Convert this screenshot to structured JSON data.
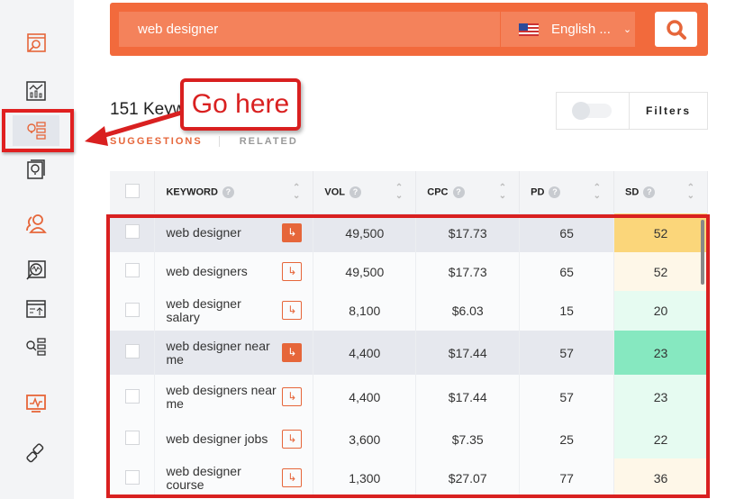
{
  "search": {
    "query": "web designer",
    "language": "English ...",
    "search_icon": "search-icon"
  },
  "sidebar": {
    "items": [
      {
        "icon": "keyword-search-icon",
        "color": "#e6663a"
      },
      {
        "icon": "chart-icon",
        "color": "#333333"
      },
      {
        "icon": "keyword-ideas-icon",
        "color": "#e6663a",
        "active": true
      },
      {
        "icon": "content-ideas-icon",
        "color": "#333333"
      },
      {
        "icon": "users-icon",
        "color": "#e6663a"
      },
      {
        "icon": "site-audit-icon",
        "color": "#333333"
      },
      {
        "icon": "top-pages-icon",
        "color": "#333333"
      },
      {
        "icon": "keyword-list-icon",
        "color": "#333333"
      },
      {
        "icon": "rank-tracking-icon",
        "color": "#e6663a"
      },
      {
        "icon": "backlinks-icon",
        "color": "#333333"
      }
    ]
  },
  "main": {
    "title": "151 Keyw",
    "tabs": [
      {
        "label": "SUGGESTIONS",
        "active": true
      },
      {
        "label": "RELATED"
      }
    ],
    "filters_label": "Filters"
  },
  "annotation": {
    "callout": "Go here"
  },
  "table": {
    "columns": [
      "KEYWORD",
      "VOL",
      "CPC",
      "PD",
      "SD"
    ],
    "rows": [
      {
        "keyword": "web designer",
        "vol": "49,500",
        "cpc": "$17.73",
        "pd": "65",
        "sd": "52",
        "sd_color": "#fbd67a",
        "hover": true
      },
      {
        "keyword": "web designers",
        "vol": "49,500",
        "cpc": "$17.73",
        "pd": "65",
        "sd": "52",
        "sd_color": "#fef7e8"
      },
      {
        "keyword": "web designer salary",
        "vol": "8,100",
        "cpc": "$6.03",
        "pd": "15",
        "sd": "20",
        "sd_color": "#e6fbf1"
      },
      {
        "keyword": "web designer near me",
        "vol": "4,400",
        "cpc": "$17.44",
        "pd": "57",
        "sd": "23",
        "sd_color": "#86e8c0",
        "hover": true
      },
      {
        "keyword": "web designers near me",
        "vol": "4,400",
        "cpc": "$17.44",
        "pd": "57",
        "sd": "23",
        "sd_color": "#e6fbf1"
      },
      {
        "keyword": "web designer jobs",
        "vol": "3,600",
        "cpc": "$7.35",
        "pd": "25",
        "sd": "22",
        "sd_color": "#e6fbf1"
      },
      {
        "keyword": "web designer course",
        "vol": "1,300",
        "cpc": "$27.07",
        "pd": "77",
        "sd": "36",
        "sd_color": "#fef7e8"
      }
    ]
  },
  "colors": {
    "accent": "#f26a3c",
    "annotation": "#d92020"
  }
}
